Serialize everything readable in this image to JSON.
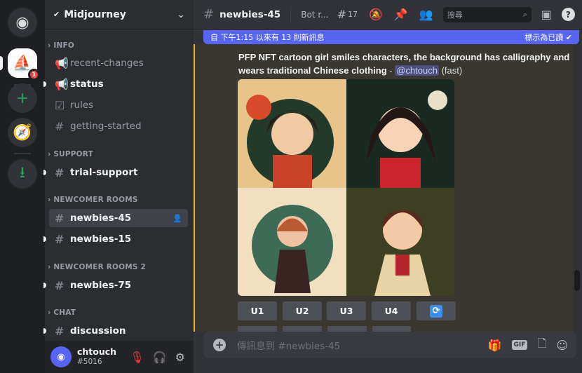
{
  "servers": [
    {
      "name": "discord-home"
    },
    {
      "name": "midjourney",
      "badge": "1"
    },
    {
      "name": "add-server"
    },
    {
      "name": "explore"
    },
    {
      "name": "download"
    }
  ],
  "guild": {
    "name": "Midjourney"
  },
  "categories": {
    "info": "INFO",
    "support": "SUPPORT",
    "newcomer": "NEWCOMER ROOMS",
    "newcomer2": "NEWCOMER ROOMS 2",
    "chat": "CHAT"
  },
  "channels": {
    "recent_changes": "recent-changes",
    "status": "status",
    "rules": "rules",
    "getting_started": "getting-started",
    "trial_support": "trial-support",
    "newbies45": "newbies-45",
    "newbies15": "newbies-15",
    "newbies75": "newbies-75",
    "discussion": "discussion"
  },
  "user": {
    "name": "chtouch",
    "tag": "#5016"
  },
  "header": {
    "channel": "newbies-45",
    "topic": "Bot r...",
    "threads": "17",
    "search_placeholder": "搜尋"
  },
  "banner": {
    "text": "自 下午1:15 以來有 13 則新訊息",
    "mark_read": "標示為已讀"
  },
  "message": {
    "prompt": "PFP NFT cartoon girl smiles characters, the background has calligraphy and wears traditional Chinese clothing",
    "dash": " - ",
    "mention": "@chtouch",
    "mode": "(fast)"
  },
  "buttons": {
    "u1": "U1",
    "u2": "U2",
    "u3": "U3",
    "u4": "U4"
  },
  "composer": {
    "placeholder": "傳訊息到 #newbies-45",
    "gif": "GIF"
  },
  "colors": {
    "accent": "#5865f2",
    "mention_highlight": "#f0b232"
  }
}
